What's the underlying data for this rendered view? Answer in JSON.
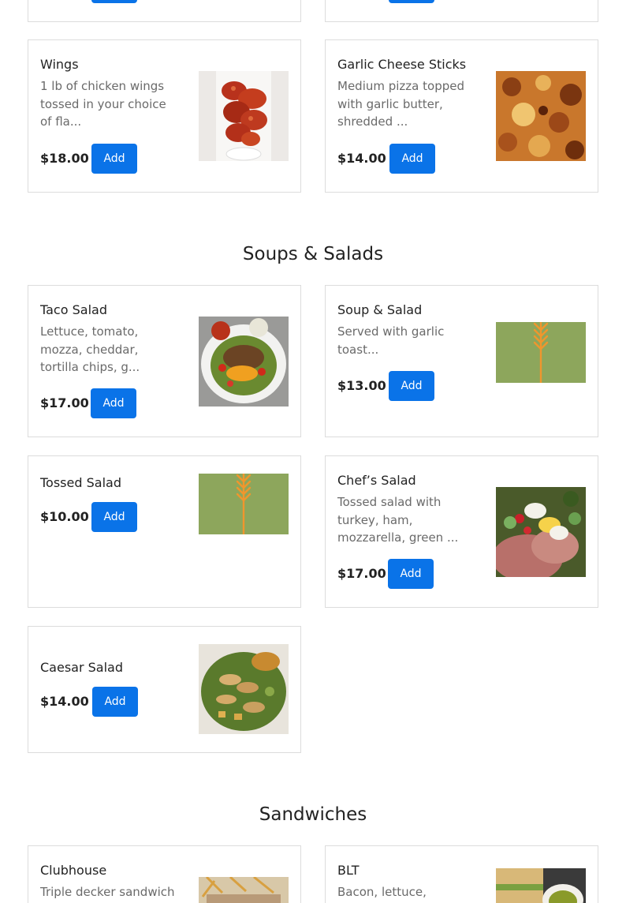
{
  "sections": [
    {
      "title": "Soups & Salads"
    },
    {
      "title": "Sandwiches"
    }
  ],
  "items": {
    "wings": {
      "name": "Wings",
      "desc": "1 lb of chicken wings tossed in your choice of fla...",
      "price": "$18.00",
      "button": "Add",
      "photo": "buffalo-wings-photo"
    },
    "garlic_cheese_sticks": {
      "name": "Garlic Cheese Sticks",
      "desc": "Medium pizza topped with garlic butter, shredded ...",
      "price": "$14.00",
      "button": "Add",
      "photo": "cheese-pizza-photo"
    },
    "taco_salad": {
      "name": "Taco Salad",
      "desc": "Lettuce, tomato, mozza, cheddar, tortilla chips, g...",
      "price": "$17.00",
      "button": "Add",
      "photo": "taco-salad-photo"
    },
    "soup_salad": {
      "name": "Soup & Salad",
      "desc": "Served with garlic toast...",
      "price": "$13.00",
      "button": "Add",
      "photo": "wheat-placeholder-icon"
    },
    "tossed_salad": {
      "name": "Tossed Salad",
      "price": "$10.00",
      "button": "Add",
      "photo": "wheat-placeholder-icon"
    },
    "chefs_salad": {
      "name": "Chef’s Salad",
      "desc": "Tossed salad with turkey, ham, mozzarella, green ...",
      "price": "$17.00",
      "button": "Add",
      "photo": "chefs-salad-photo"
    },
    "caesar_salad": {
      "name": "Caesar Salad",
      "price": "$14.00",
      "button": "Add",
      "photo": "caesar-salad-photo"
    },
    "clubhouse": {
      "name": "Clubhouse",
      "desc": "Triple decker sandwich",
      "photo": "clubhouse-fries-photo"
    },
    "blt": {
      "name": "BLT",
      "desc": "Bacon, lettuce,",
      "photo": "blt-soup-photo"
    }
  },
  "colors": {
    "accent": "#0a73e8",
    "placeholder_bg": "#8da65c",
    "placeholder_icon": "#f0962d"
  }
}
